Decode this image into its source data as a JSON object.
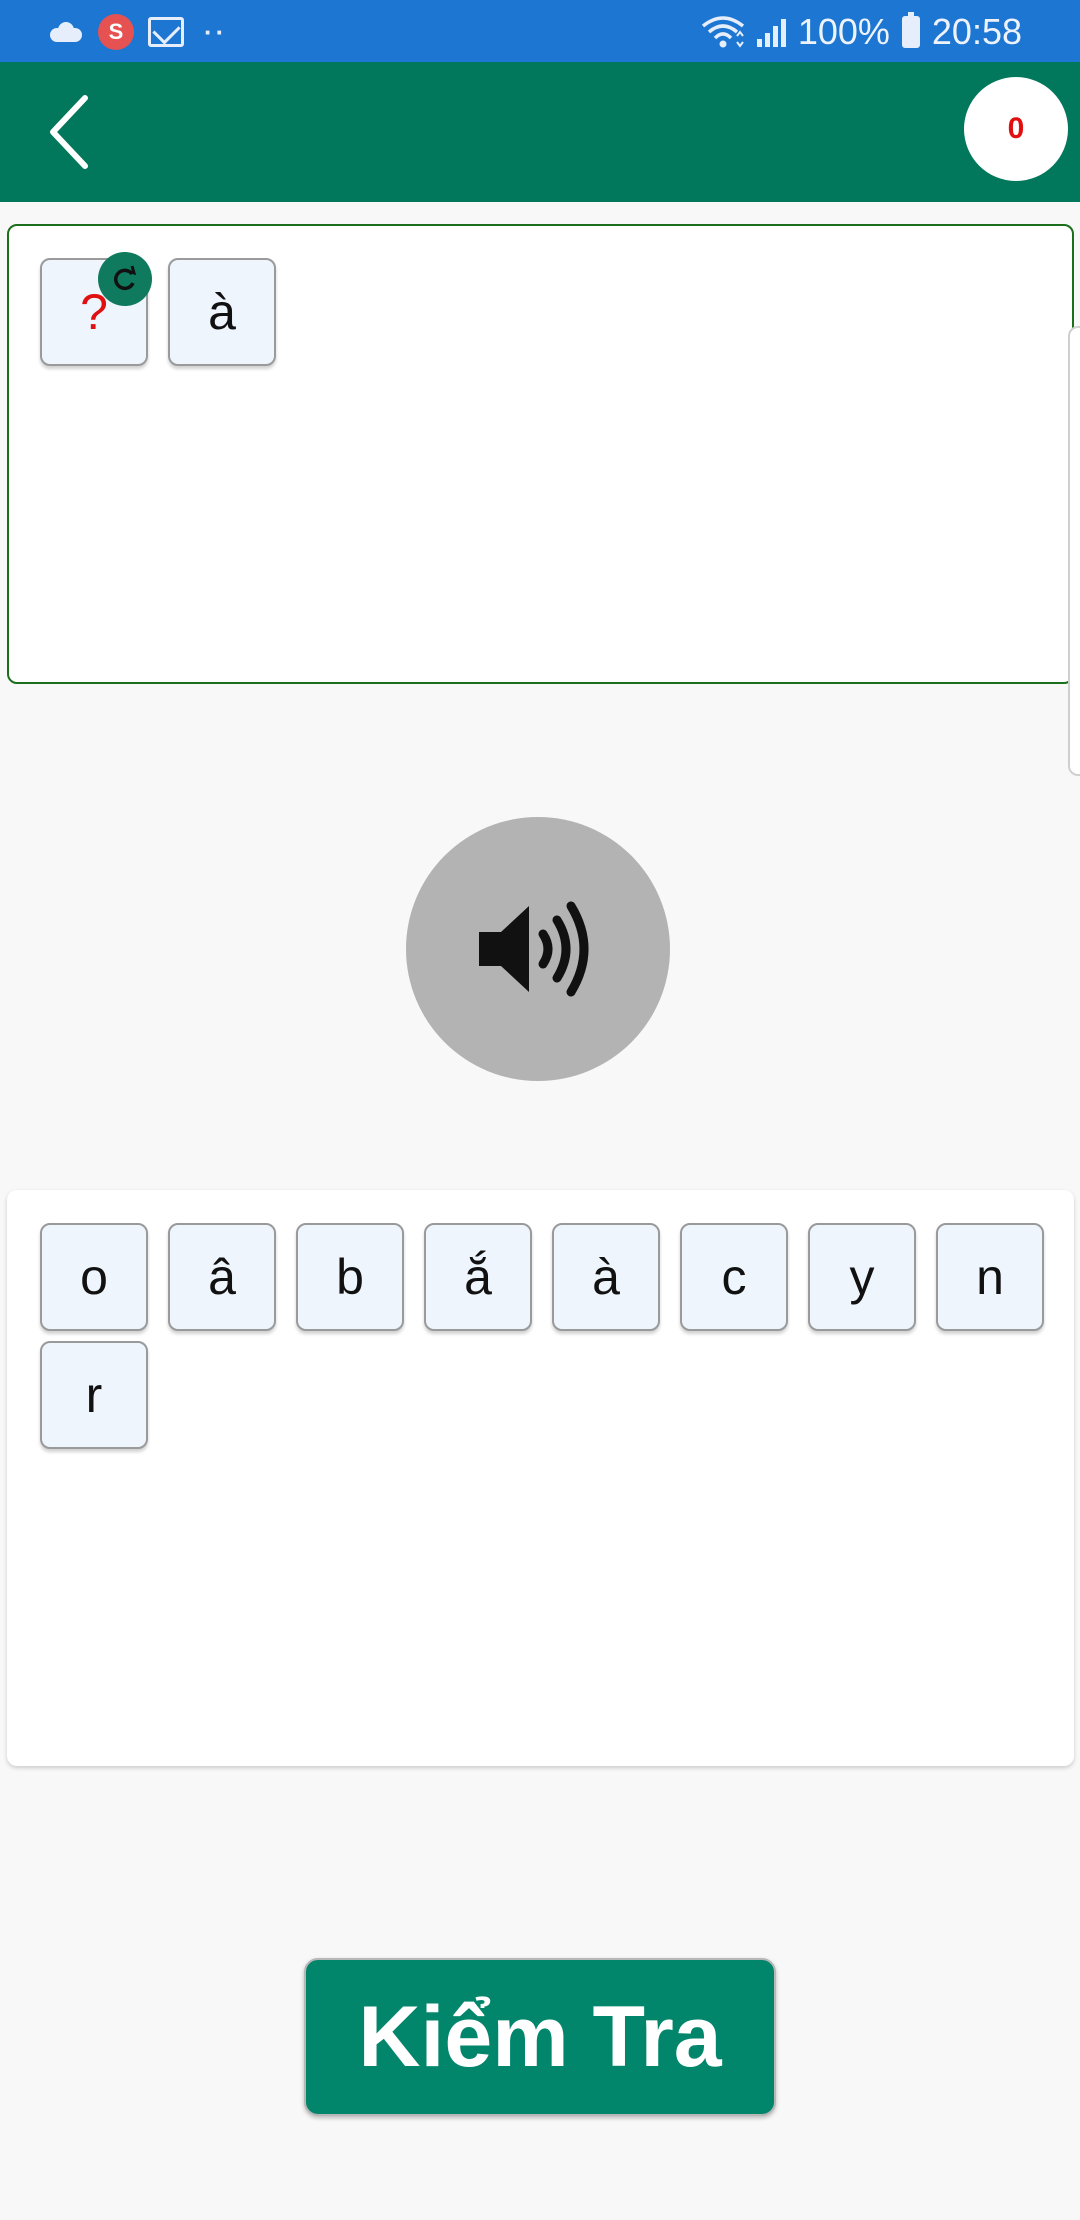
{
  "status_bar": {
    "notif_s": "S",
    "dots": "··",
    "battery": "100%",
    "time": "20:58"
  },
  "header": {
    "score": "0"
  },
  "answer": {
    "slots": [
      "?",
      "à"
    ]
  },
  "pool": {
    "letters": [
      "o",
      "â",
      "b",
      "ắ",
      "à",
      "c",
      "y",
      "n",
      "r"
    ]
  },
  "actions": {
    "check_label": "Kiểm Tra"
  },
  "colors": {
    "status_bar": "#1c76d2",
    "app_bar": "#01775c",
    "score_text": "#e01010",
    "check_button": "#02866b",
    "tile_bg": "#eef5fd",
    "speaker_bg": "#b3b3b3"
  },
  "icons": [
    "cloud-icon",
    "s-notification-icon",
    "mail-icon",
    "wifi-icon",
    "signal-icon",
    "battery-icon",
    "back-arrow-icon",
    "refresh-icon",
    "speaker-icon"
  ]
}
